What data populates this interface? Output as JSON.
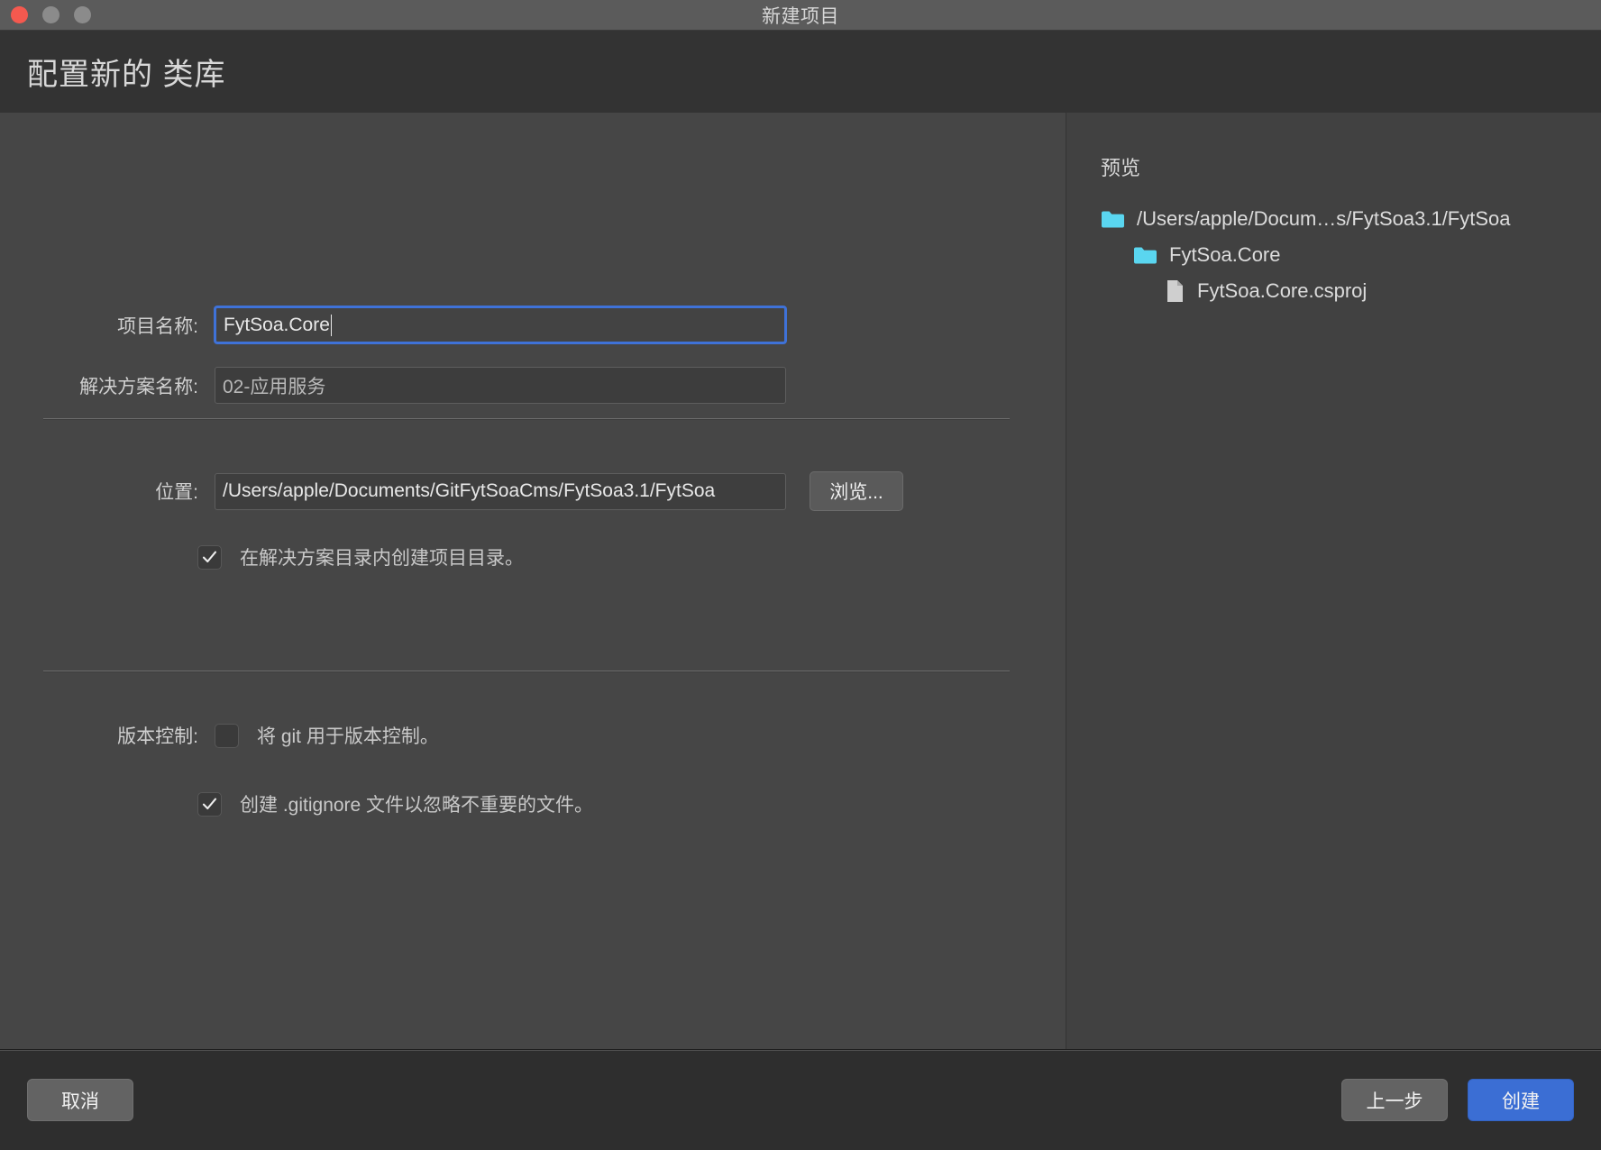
{
  "window": {
    "title": "新建项目",
    "traffic_lights": [
      "close",
      "minimize",
      "maximize"
    ]
  },
  "header": {
    "title": "配置新的 类库"
  },
  "form": {
    "project_name": {
      "label": "项目名称:",
      "value": "FytSoa.Core",
      "focused": true
    },
    "solution_name": {
      "label": "解决方案名称:",
      "value": "02-应用服务",
      "focused": false
    },
    "location": {
      "label": "位置:",
      "value": "/Users/apple/Documents/GitFytSoaCms/FytSoa3.1/FytSoa",
      "browse_label": "浏览..."
    },
    "create_project_dir": {
      "label": "在解决方案目录内创建项目目录。",
      "checked": true
    },
    "version_control": {
      "label": "版本控制:",
      "use_git": {
        "label": "将 git 用于版本控制。",
        "checked": false
      },
      "create_gitignore": {
        "label": "创建 .gitignore 文件以忽略不重要的文件。",
        "checked": true
      }
    }
  },
  "preview": {
    "title": "预览",
    "tree": [
      {
        "icon": "folder-icon",
        "label": "/Users/apple/Docum…s/FytSoa3.1/FytSoa",
        "depth": 1
      },
      {
        "icon": "folder-icon",
        "label": "FytSoa.Core",
        "depth": 2
      },
      {
        "icon": "file-icon",
        "label": "FytSoa.Core.csproj",
        "depth": 3
      }
    ]
  },
  "footer": {
    "cancel_label": "取消",
    "back_label": "上一步",
    "create_label": "创建"
  },
  "colors": {
    "accent": "#3b6ed4",
    "focus_ring": "#3f72d8",
    "folder": "#5ad6f0",
    "titlebar": "#5b5b5b",
    "header_band": "#333333",
    "body": "#464646",
    "footer": "#2e2e2e"
  }
}
